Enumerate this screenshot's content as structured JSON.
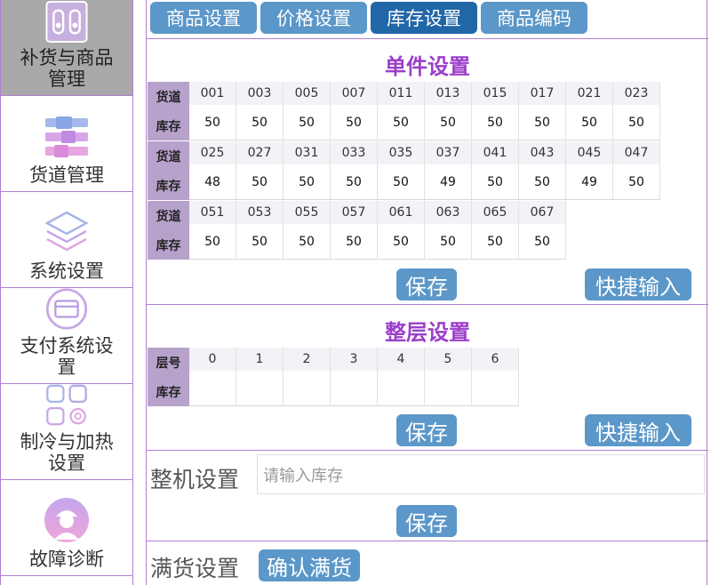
{
  "sidebar": {
    "items": [
      {
        "label": "补货与商品管理",
        "icon": "vending-machine-icon"
      },
      {
        "label": "货道管理",
        "icon": "slots-icon"
      },
      {
        "label": "系统设置",
        "icon": "layers-icon"
      },
      {
        "label": "支付系统设置",
        "icon": "credit-card-icon"
      },
      {
        "label": "制冷与加热设置",
        "icon": "grid-gear-icon"
      },
      {
        "label": "故障诊断",
        "icon": "technician-icon"
      }
    ]
  },
  "tabs": [
    "商品设置",
    "价格设置",
    "库存设置",
    "商品编码"
  ],
  "active_tab": "库存设置",
  "single": {
    "title": "单件设置",
    "header_slot": "货道",
    "header_stock": "库存",
    "rows": [
      {
        "slots": [
          "001",
          "003",
          "005",
          "007",
          "011",
          "013",
          "015",
          "017",
          "021",
          "023"
        ],
        "stock": [
          "50",
          "50",
          "50",
          "50",
          "50",
          "50",
          "50",
          "50",
          "50",
          "50"
        ]
      },
      {
        "slots": [
          "025",
          "027",
          "031",
          "033",
          "035",
          "037",
          "041",
          "043",
          "045",
          "047"
        ],
        "stock": [
          "48",
          "50",
          "50",
          "50",
          "50",
          "49",
          "50",
          "50",
          "49",
          "50"
        ]
      },
      {
        "slots": [
          "051",
          "053",
          "055",
          "057",
          "061",
          "063",
          "065",
          "067"
        ],
        "stock": [
          "50",
          "50",
          "50",
          "50",
          "50",
          "50",
          "50",
          "50"
        ]
      }
    ],
    "save": "保存",
    "quick": "快捷输入"
  },
  "layer": {
    "title": "整层设置",
    "header_layer": "层号",
    "header_stock": "库存",
    "layers": [
      "0",
      "1",
      "2",
      "3",
      "4",
      "5",
      "6"
    ],
    "stock": [
      "",
      "",
      "",
      "",
      "",
      "",
      ""
    ],
    "save": "保存",
    "quick": "快捷输入"
  },
  "machine": {
    "label": "整机设置",
    "placeholder": "请输入库存",
    "save": "保存"
  },
  "full": {
    "label": "满货设置",
    "confirm": "确认满货"
  },
  "colors": {
    "accent": "#5b97c8",
    "accent_active": "#2167a8",
    "title_purple": "#9b3fc9",
    "header_purple": "#b7a2cc",
    "border": "#b27fd0"
  }
}
